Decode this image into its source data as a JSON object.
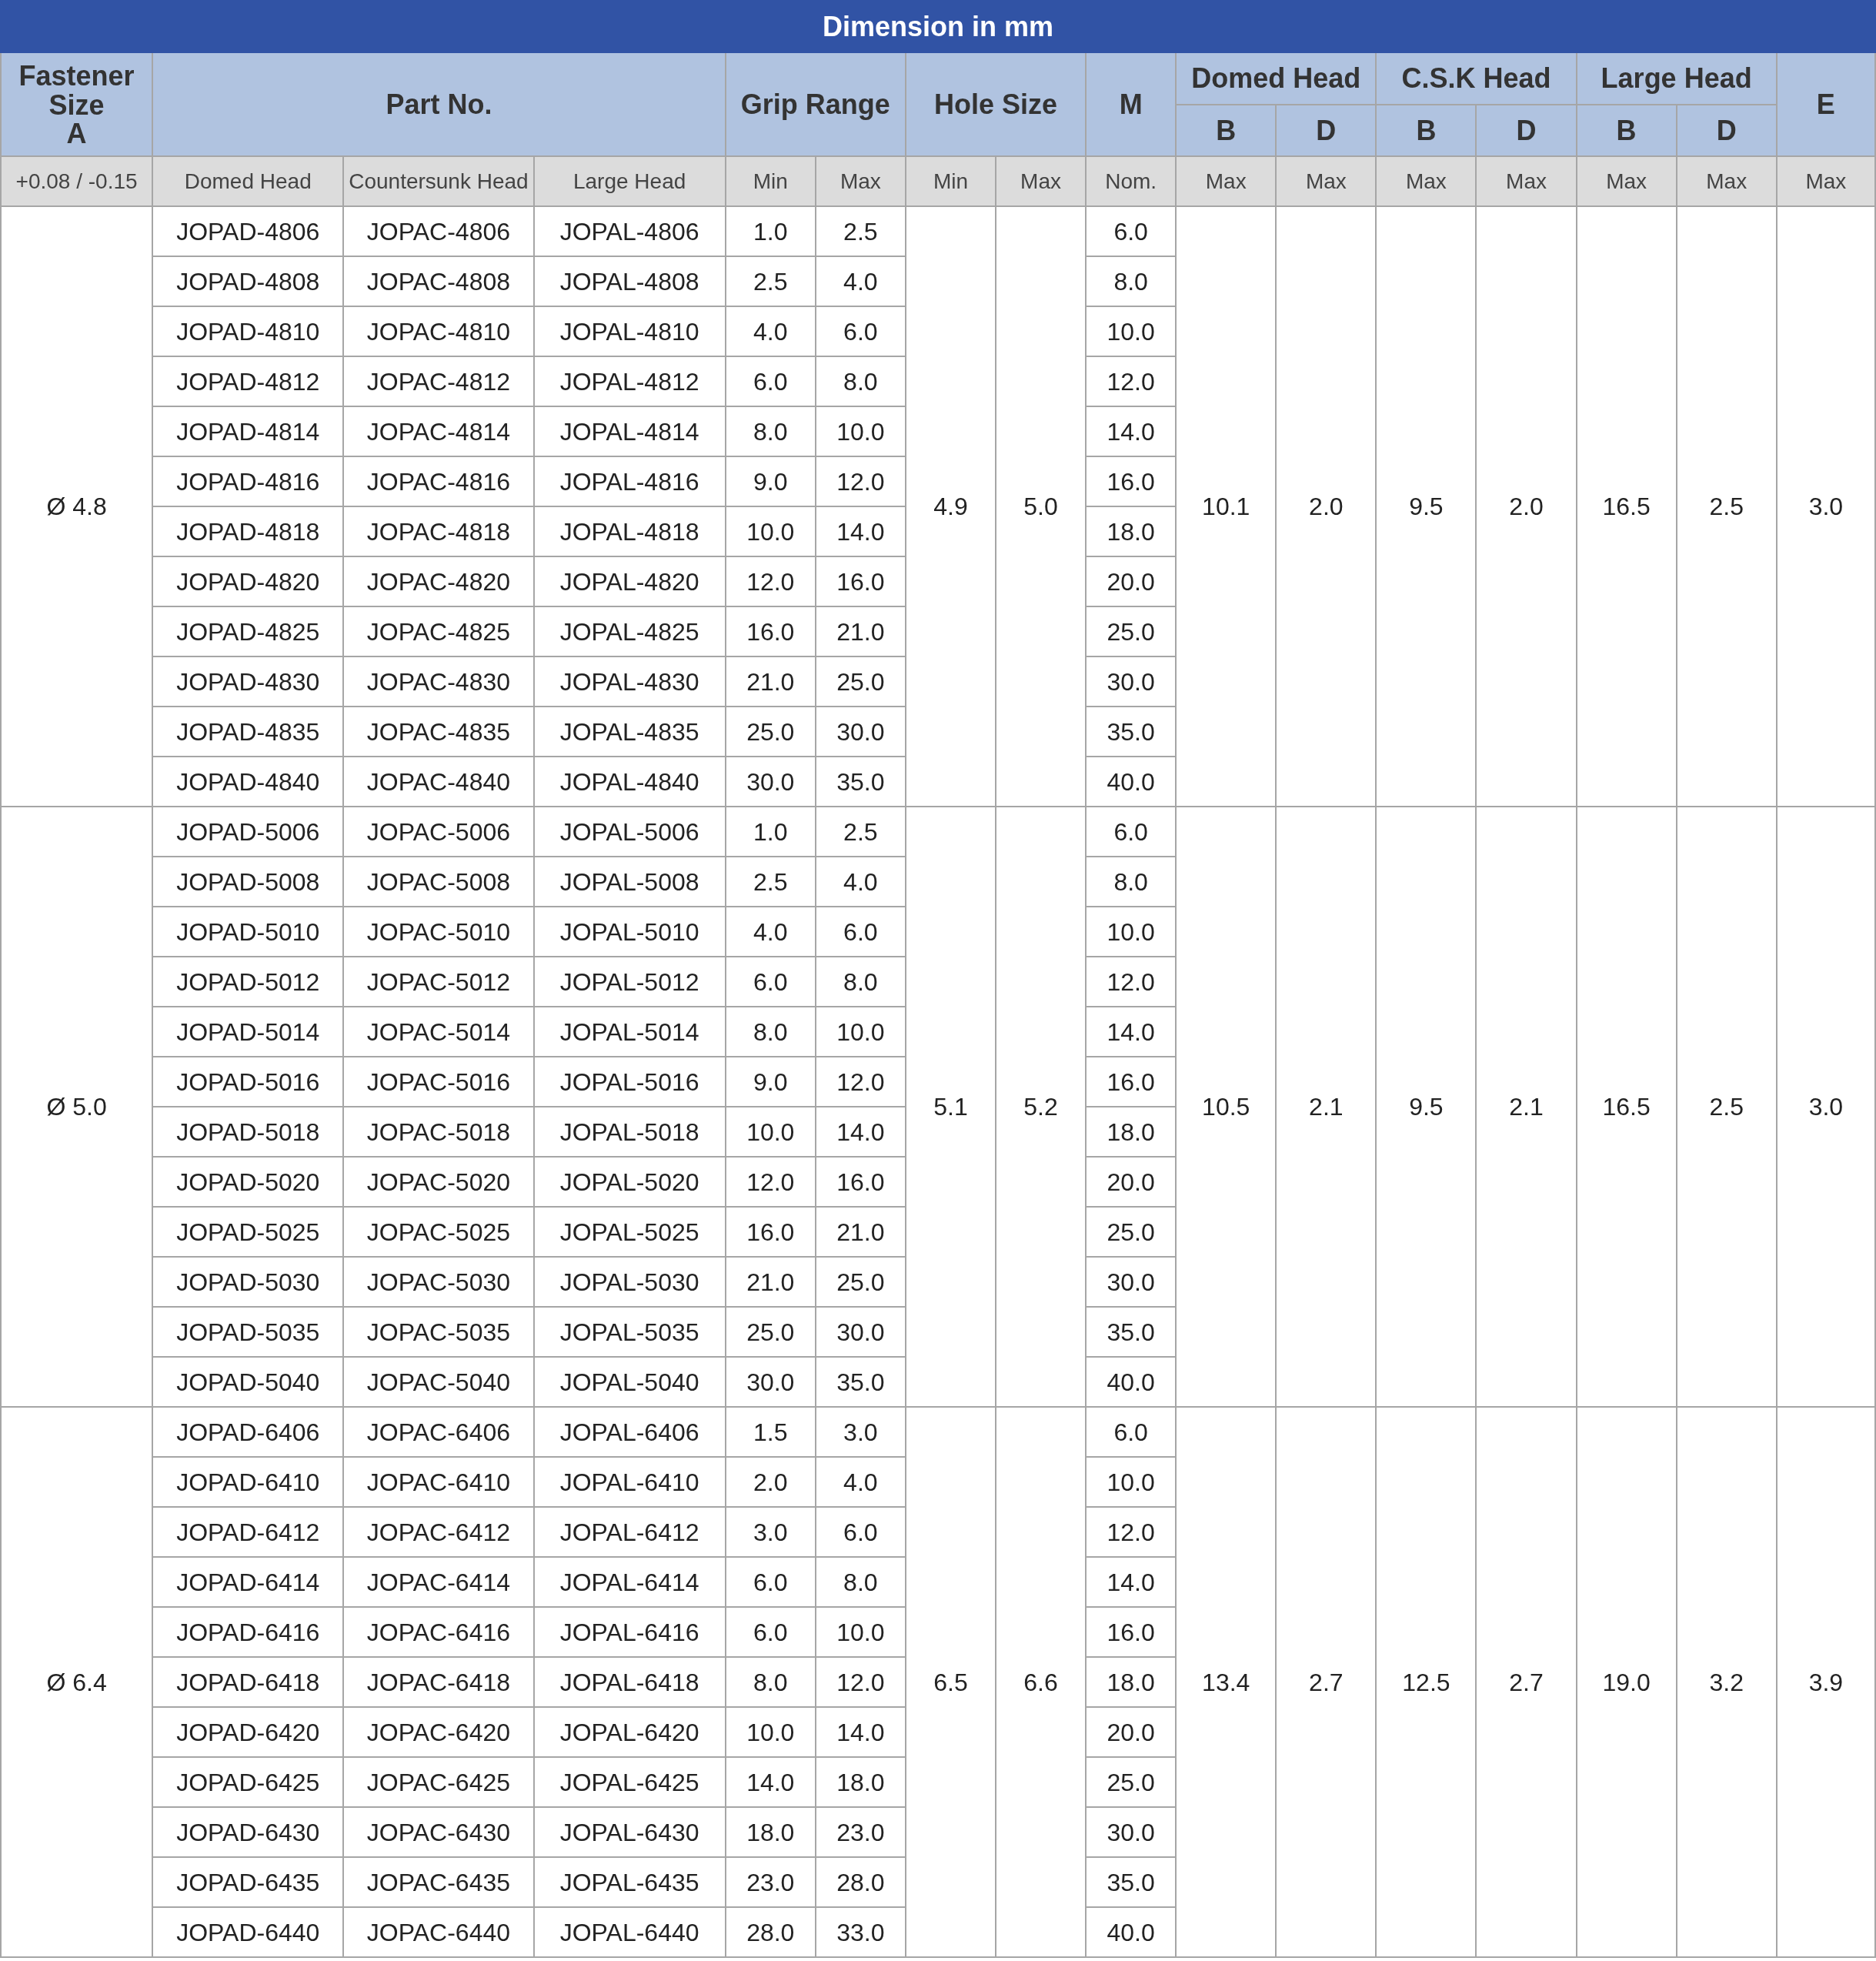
{
  "title": "Dimension in mm",
  "header": {
    "fastener_size": "Fastener Size",
    "fastener_letter": "A",
    "part_no": "Part No.",
    "grip_range": "Grip Range",
    "hole_size": "Hole Size",
    "m": "M",
    "domed_head": "Domed Head",
    "csk_head": "C.S.K Head",
    "large_head": "Large Head",
    "e": "E",
    "domed_b": "B",
    "domed_d": "D",
    "csk_b": "B",
    "csk_d": "D",
    "large_b": "B",
    "large_d": "D"
  },
  "subheader": [
    "+0.08 / -0.15",
    "Domed Head",
    "Countersunk Head",
    "Large Head",
    "Min",
    "Max",
    "Min",
    "Max",
    "Nom.",
    "Max",
    "Max",
    "Max",
    "Max",
    "Max",
    "Max",
    "Max"
  ],
  "groups": [
    {
      "size": "Ø 4.8",
      "hole_min": "4.9",
      "hole_max": "5.0",
      "domed_b": "10.1",
      "domed_d": "2.0",
      "csk_b": "9.5",
      "csk_d": "2.0",
      "large_b": "16.5",
      "large_d": "2.5",
      "e": "3.0",
      "rows": [
        {
          "domed": "JOPAD-4806",
          "countersunk": "JOPAC-4806",
          "large": "JOPAL-4806",
          "grip_min": "1.0",
          "grip_max": "2.5",
          "m": "6.0"
        },
        {
          "domed": "JOPAD-4808",
          "countersunk": "JOPAC-4808",
          "large": "JOPAL-4808",
          "grip_min": "2.5",
          "grip_max": "4.0",
          "m": "8.0"
        },
        {
          "domed": "JOPAD-4810",
          "countersunk": "JOPAC-4810",
          "large": "JOPAL-4810",
          "grip_min": "4.0",
          "grip_max": "6.0",
          "m": "10.0"
        },
        {
          "domed": "JOPAD-4812",
          "countersunk": "JOPAC-4812",
          "large": "JOPAL-4812",
          "grip_min": "6.0",
          "grip_max": "8.0",
          "m": "12.0"
        },
        {
          "domed": "JOPAD-4814",
          "countersunk": "JOPAC-4814",
          "large": "JOPAL-4814",
          "grip_min": "8.0",
          "grip_max": "10.0",
          "m": "14.0"
        },
        {
          "domed": "JOPAD-4816",
          "countersunk": "JOPAC-4816",
          "large": "JOPAL-4816",
          "grip_min": "9.0",
          "grip_max": "12.0",
          "m": "16.0"
        },
        {
          "domed": "JOPAD-4818",
          "countersunk": "JOPAC-4818",
          "large": "JOPAL-4818",
          "grip_min": "10.0",
          "grip_max": "14.0",
          "m": "18.0"
        },
        {
          "domed": "JOPAD-4820",
          "countersunk": "JOPAC-4820",
          "large": "JOPAL-4820",
          "grip_min": "12.0",
          "grip_max": "16.0",
          "m": "20.0"
        },
        {
          "domed": "JOPAD-4825",
          "countersunk": "JOPAC-4825",
          "large": "JOPAL-4825",
          "grip_min": "16.0",
          "grip_max": "21.0",
          "m": "25.0"
        },
        {
          "domed": "JOPAD-4830",
          "countersunk": "JOPAC-4830",
          "large": "JOPAL-4830",
          "grip_min": "21.0",
          "grip_max": "25.0",
          "m": "30.0"
        },
        {
          "domed": "JOPAD-4835",
          "countersunk": "JOPAC-4835",
          "large": "JOPAL-4835",
          "grip_min": "25.0",
          "grip_max": "30.0",
          "m": "35.0"
        },
        {
          "domed": "JOPAD-4840",
          "countersunk": "JOPAC-4840",
          "large": "JOPAL-4840",
          "grip_min": "30.0",
          "grip_max": "35.0",
          "m": "40.0"
        }
      ]
    },
    {
      "size": "Ø 5.0",
      "hole_min": "5.1",
      "hole_max": "5.2",
      "domed_b": "10.5",
      "domed_d": "2.1",
      "csk_b": "9.5",
      "csk_d": "2.1",
      "large_b": "16.5",
      "large_d": "2.5",
      "e": "3.0",
      "rows": [
        {
          "domed": "JOPAD-5006",
          "countersunk": "JOPAC-5006",
          "large": "JOPAL-5006",
          "grip_min": "1.0",
          "grip_max": "2.5",
          "m": "6.0"
        },
        {
          "domed": "JOPAD-5008",
          "countersunk": "JOPAC-5008",
          "large": "JOPAL-5008",
          "grip_min": "2.5",
          "grip_max": "4.0",
          "m": "8.0"
        },
        {
          "domed": "JOPAD-5010",
          "countersunk": "JOPAC-5010",
          "large": "JOPAL-5010",
          "grip_min": "4.0",
          "grip_max": "6.0",
          "m": "10.0"
        },
        {
          "domed": "JOPAD-5012",
          "countersunk": "JOPAC-5012",
          "large": "JOPAL-5012",
          "grip_min": "6.0",
          "grip_max": "8.0",
          "m": "12.0"
        },
        {
          "domed": "JOPAD-5014",
          "countersunk": "JOPAC-5014",
          "large": "JOPAL-5014",
          "grip_min": "8.0",
          "grip_max": "10.0",
          "m": "14.0"
        },
        {
          "domed": "JOPAD-5016",
          "countersunk": "JOPAC-5016",
          "large": "JOPAL-5016",
          "grip_min": "9.0",
          "grip_max": "12.0",
          "m": "16.0"
        },
        {
          "domed": "JOPAD-5018",
          "countersunk": "JOPAC-5018",
          "large": "JOPAL-5018",
          "grip_min": "10.0",
          "grip_max": "14.0",
          "m": "18.0"
        },
        {
          "domed": "JOPAD-5020",
          "countersunk": "JOPAC-5020",
          "large": "JOPAL-5020",
          "grip_min": "12.0",
          "grip_max": "16.0",
          "m": "20.0"
        },
        {
          "domed": "JOPAD-5025",
          "countersunk": "JOPAC-5025",
          "large": "JOPAL-5025",
          "grip_min": "16.0",
          "grip_max": "21.0",
          "m": "25.0"
        },
        {
          "domed": "JOPAD-5030",
          "countersunk": "JOPAC-5030",
          "large": "JOPAL-5030",
          "grip_min": "21.0",
          "grip_max": "25.0",
          "m": "30.0"
        },
        {
          "domed": "JOPAD-5035",
          "countersunk": "JOPAC-5035",
          "large": "JOPAL-5035",
          "grip_min": "25.0",
          "grip_max": "30.0",
          "m": "35.0"
        },
        {
          "domed": "JOPAD-5040",
          "countersunk": "JOPAC-5040",
          "large": "JOPAL-5040",
          "grip_min": "30.0",
          "grip_max": "35.0",
          "m": "40.0"
        }
      ]
    },
    {
      "size": "Ø 6.4",
      "hole_min": "6.5",
      "hole_max": "6.6",
      "domed_b": "13.4",
      "domed_d": "2.7",
      "csk_b": "12.5",
      "csk_d": "2.7",
      "large_b": "19.0",
      "large_d": "3.2",
      "e": "3.9",
      "rows": [
        {
          "domed": "JOPAD-6406",
          "countersunk": "JOPAC-6406",
          "large": "JOPAL-6406",
          "grip_min": "1.5",
          "grip_max": "3.0",
          "m": "6.0"
        },
        {
          "domed": "JOPAD-6410",
          "countersunk": "JOPAC-6410",
          "large": "JOPAL-6410",
          "grip_min": "2.0",
          "grip_max": "4.0",
          "m": "10.0"
        },
        {
          "domed": "JOPAD-6412",
          "countersunk": "JOPAC-6412",
          "large": "JOPAL-6412",
          "grip_min": "3.0",
          "grip_max": "6.0",
          "m": "12.0"
        },
        {
          "domed": "JOPAD-6414",
          "countersunk": "JOPAC-6414",
          "large": "JOPAL-6414",
          "grip_min": "6.0",
          "grip_max": "8.0",
          "m": "14.0"
        },
        {
          "domed": "JOPAD-6416",
          "countersunk": "JOPAC-6416",
          "large": "JOPAL-6416",
          "grip_min": "6.0",
          "grip_max": "10.0",
          "m": "16.0"
        },
        {
          "domed": "JOPAD-6418",
          "countersunk": "JOPAC-6418",
          "large": "JOPAL-6418",
          "grip_min": "8.0",
          "grip_max": "12.0",
          "m": "18.0"
        },
        {
          "domed": "JOPAD-6420",
          "countersunk": "JOPAC-6420",
          "large": "JOPAL-6420",
          "grip_min": "10.0",
          "grip_max": "14.0",
          "m": "20.0"
        },
        {
          "domed": "JOPAD-6425",
          "countersunk": "JOPAC-6425",
          "large": "JOPAL-6425",
          "grip_min": "14.0",
          "grip_max": "18.0",
          "m": "25.0"
        },
        {
          "domed": "JOPAD-6430",
          "countersunk": "JOPAC-6430",
          "large": "JOPAL-6430",
          "grip_min": "18.0",
          "grip_max": "23.0",
          "m": "30.0"
        },
        {
          "domed": "JOPAD-6435",
          "countersunk": "JOPAC-6435",
          "large": "JOPAL-6435",
          "grip_min": "23.0",
          "grip_max": "28.0",
          "m": "35.0"
        },
        {
          "domed": "JOPAD-6440",
          "countersunk": "JOPAC-6440",
          "large": "JOPAL-6440",
          "grip_min": "28.0",
          "grip_max": "33.0",
          "m": "40.0"
        }
      ]
    }
  ]
}
